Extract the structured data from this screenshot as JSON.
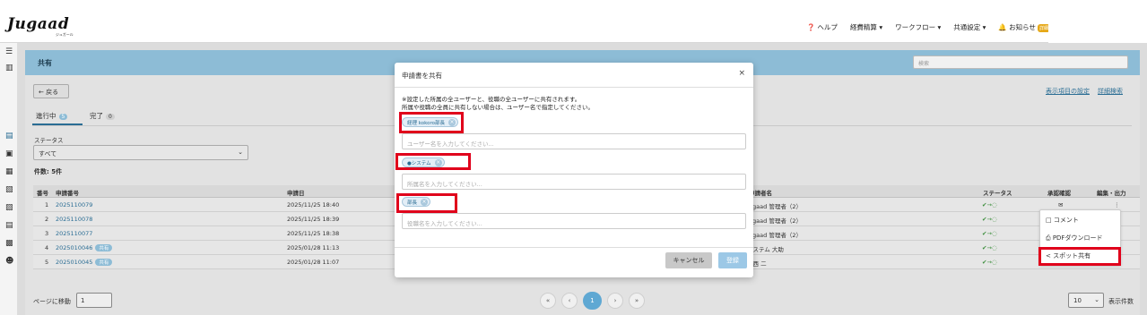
{
  "app": {
    "logo": "Jugaad",
    "logo_sub": "ジュガール"
  },
  "nav": {
    "help": "❓ ヘルプ",
    "expense": "経費精算 ▾",
    "workflow": "ワークフロー ▾",
    "common": "共通設定 ▾",
    "notice": "🔔 お知らせ",
    "notice_badge": "詳細"
  },
  "page": {
    "title": "共有",
    "search_placeholder": "検索",
    "back": "← 戻る",
    "tab_active": "進行中",
    "tab_active_count": "5",
    "tab_done": "完了",
    "tab_done_count": "0",
    "display_settings": "表示項目の設定",
    "advanced_search": "詳細検索",
    "status_label": "ステータス",
    "status_value": "すべて",
    "result_count": "件数: 5件"
  },
  "table": {
    "headers": {
      "no": "番号",
      "app_no": "申請番号",
      "date": "申請日",
      "applicant": "申請者名",
      "status": "ステータス",
      "approval": "承認確認",
      "edit": "編集・出力"
    },
    "rows": [
      {
        "no": "1",
        "app_no": "2025110079",
        "shared": "",
        "date": "2025/11/25 18:40",
        "applicant": "Jugaad 管理者（2）"
      },
      {
        "no": "2",
        "app_no": "2025110078",
        "shared": "",
        "date": "2025/11/25 18:39",
        "applicant": "Jugaad 管理者（2）"
      },
      {
        "no": "3",
        "app_no": "2025110077",
        "shared": "",
        "date": "2025/11/25 18:38",
        "applicant": "Jugaad 管理者（2）"
      },
      {
        "no": "4",
        "app_no": "2025010046",
        "shared": "共有",
        "date": "2025/01/28 11:13",
        "applicant": "システム 大助"
      },
      {
        "no": "5",
        "app_no": "2025010045",
        "shared": "共有",
        "date": "2025/01/28 11:07",
        "applicant": "渡西 二"
      }
    ]
  },
  "menu": {
    "comment": "□ コメント",
    "pdf": "⎙ PDFダウンロード",
    "spot_share": "< スポット共有"
  },
  "pagination": {
    "goto_label": "ページに移動",
    "goto_value": "1",
    "first": "«",
    "prev": "‹",
    "current": "1",
    "next": "›",
    "last": "»",
    "per_page": "10",
    "per_page_label": "表示件数"
  },
  "modal": {
    "title": "申請書を共有",
    "close": "×",
    "note1": "※設定した所属の全ユーザーと、役職の全ユーザーに共有されます。",
    "note2": "所属や役職の全員に共有しない場合は、ユーザー名で指定してください。",
    "user_chip": "経理 kokoro部長",
    "user_placeholder": "ユーザー名を入力してください...",
    "dept_chip": "●システム",
    "dept_placeholder": "所属名を入力してください...",
    "role_chip": "部長",
    "role_placeholder": "役職名を入力してください...",
    "cancel": "キャンセル",
    "submit": "登録"
  }
}
